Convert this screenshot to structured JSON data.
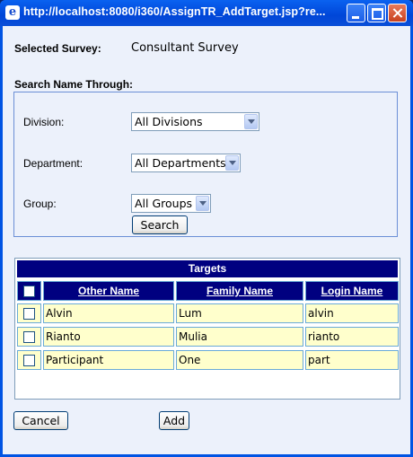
{
  "window": {
    "title": "http://localhost:8080/i360/AssignTR_AddTarget.jsp?re...",
    "icon": "ie-page-icon"
  },
  "survey": {
    "label": "Selected Survey:",
    "value": "Consultant Survey"
  },
  "search": {
    "heading": "Search Name Through:",
    "division_label": "Division:",
    "division_value": "All Divisions",
    "department_label": "Department:",
    "department_value": "All Departments",
    "group_label": "Group:",
    "group_value": "All Groups",
    "button": "Search"
  },
  "targets": {
    "title": "Targets",
    "columns": [
      "Other Name",
      "Family Name",
      "Login Name"
    ],
    "rows": [
      {
        "other": "Alvin",
        "family": "Lum",
        "login": "alvin"
      },
      {
        "other": "Rianto",
        "family": "Mulia",
        "login": "rianto"
      },
      {
        "other": "Participant",
        "family": "One",
        "login": "part"
      }
    ]
  },
  "actions": {
    "cancel": "Cancel",
    "add": "Add"
  },
  "colors": {
    "header_navy": "#000080",
    "row_fill": "#ffffcc",
    "background": "#ecf1fb"
  }
}
